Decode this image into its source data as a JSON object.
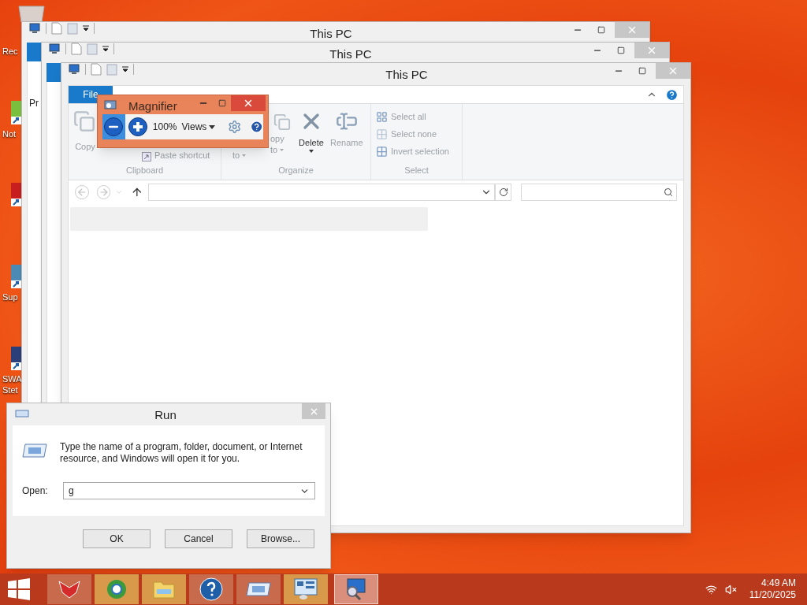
{
  "desktop": {
    "icons": [
      {
        "label": "Rec"
      },
      {
        "label": "Not"
      },
      {
        "label": "Sup"
      },
      {
        "label": "SWA Stet"
      }
    ]
  },
  "back_windows": [
    {
      "title": "This PC",
      "pane_text": "Pr"
    },
    {
      "title": "This PC"
    }
  ],
  "explorer": {
    "title": "This PC",
    "tabs": [
      {
        "label": "File",
        "selected": true
      }
    ],
    "clipboard": {
      "copy": "Copy",
      "paste_shortcut": "Paste shortcut",
      "group": "Clipboard"
    },
    "organize": {
      "move_fragment": "to",
      "copy_fragment": "opy",
      "copy_fragment_2": "to",
      "delete": "Delete",
      "rename": "Rename",
      "group": "Organize"
    },
    "select": {
      "items": [
        {
          "kind": "all",
          "label": "Select all"
        },
        {
          "kind": "none",
          "label": "Select none"
        },
        {
          "kind": "invert",
          "label": "Invert selection"
        }
      ],
      "group": "Select"
    }
  },
  "magnifier": {
    "title": "Magnifier",
    "buttons": [
      {
        "kind": "zoom-out",
        "selected": true
      },
      {
        "kind": "zoom-in",
        "selected": false
      }
    ],
    "zoom": "100%",
    "views": "Views"
  },
  "run": {
    "title": "Run",
    "message": "Type the name of a program, folder, document, or Internet resource, and Windows will open it for you.",
    "open_label": "Open:",
    "value": "g",
    "buttons": [
      "OK",
      "Cancel",
      "Browse..."
    ]
  },
  "taskbar": {
    "apps": [
      {
        "kind": "fox",
        "selected": false
      },
      {
        "kind": "globe",
        "selected": false
      },
      {
        "kind": "folder",
        "selected": false
      },
      {
        "kind": "help",
        "selected": false
      },
      {
        "kind": "run",
        "selected": false
      },
      {
        "kind": "panel",
        "selected": false
      },
      {
        "kind": "magnifier",
        "selected": true
      }
    ],
    "time": "4:49 AM",
    "date": "11/20/2025"
  }
}
